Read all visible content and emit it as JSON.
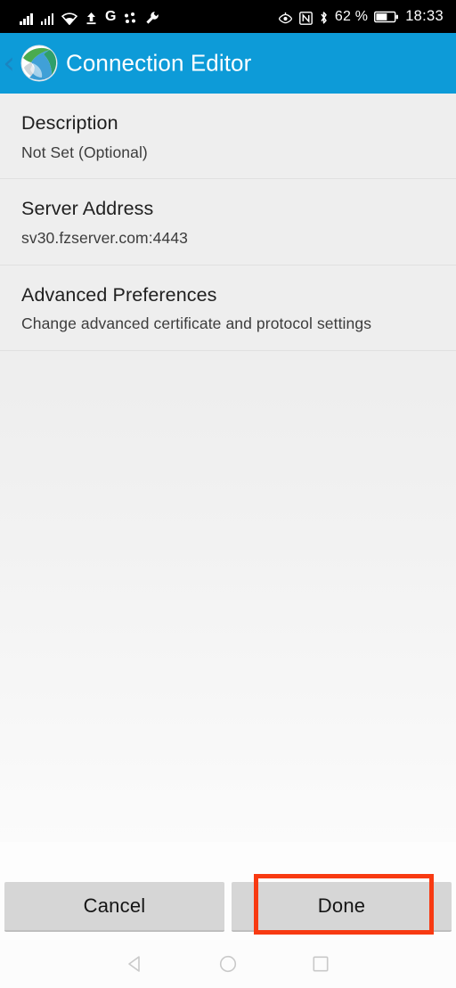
{
  "status_bar": {
    "icons_left": [
      {
        "name": "signal-bars-sim1-icon",
        "glyph": "bars"
      },
      {
        "name": "signal-bars-sim2-icon",
        "glyph": "bars"
      },
      {
        "name": "wifi-icon",
        "glyph": "wifi"
      },
      {
        "name": "upload-icon",
        "glyph": "upload"
      },
      {
        "name": "google-icon",
        "glyph": "G"
      },
      {
        "name": "dots-icon",
        "glyph": "dots"
      },
      {
        "name": "wrench-icon",
        "glyph": "wrench"
      }
    ],
    "icons_right": [
      {
        "name": "eye-comfort-icon",
        "glyph": "eye"
      },
      {
        "name": "nfc-icon",
        "glyph": "N"
      },
      {
        "name": "bluetooth-icon",
        "glyph": "bt"
      }
    ],
    "battery_percent": "62 %",
    "time": "18:33"
  },
  "header": {
    "back_label": "‹",
    "title": "Connection Editor",
    "logo_name": "filezilla-logo",
    "background_color": "#0d9bd8"
  },
  "list": [
    {
      "id": "description",
      "title": "Description",
      "subtitle": "Not Set (Optional)"
    },
    {
      "id": "server-address",
      "title": "Server Address",
      "subtitle": "sv30.fzserver.com:4443"
    },
    {
      "id": "advanced-preferences",
      "title": "Advanced Preferences",
      "subtitle": "Change advanced certificate and protocol settings"
    }
  ],
  "footer": {
    "cancel_label": "Cancel",
    "done_label": "Done",
    "highlight_color": "#f83a12",
    "highlight_target": "done-button"
  },
  "nav_bar": {
    "back_label": "back-triangle",
    "home_label": "home-circle",
    "recents_label": "recents-square"
  }
}
